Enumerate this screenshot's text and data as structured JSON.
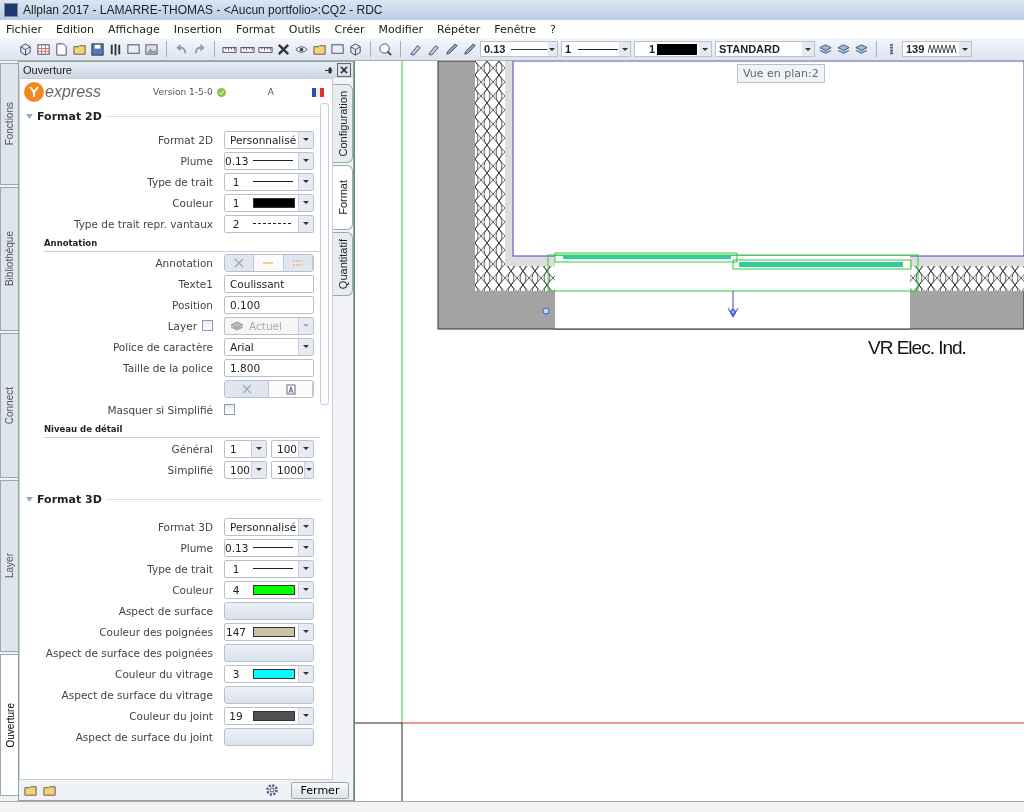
{
  "window": {
    "title": "Allplan 2017 - LAMARRE-THOMAS - <Aucun portfolio>:CQ2 - RDC"
  },
  "menu": [
    "Fichier",
    "Edition",
    "Affichage",
    "Insertion",
    "Format",
    "Outils",
    "Créer",
    "Modifier",
    "Répéter",
    "Fenêtre",
    "?"
  ],
  "toolbar": {
    "pen": "0.13",
    "line_type": "1",
    "color_number": "1",
    "layer": "STANDARD",
    "pattern": "139"
  },
  "tooltip": "Vue en plan:2",
  "left_tabs": [
    {
      "label": "Fonctions",
      "selected": false
    },
    {
      "label": "Bibliothèque",
      "selected": false
    },
    {
      "label": "Connect",
      "selected": false
    },
    {
      "label": "Layer",
      "selected": false
    },
    {
      "label": "Ouverture",
      "selected": true
    }
  ],
  "panel": {
    "title": "Ouverture",
    "logo": "express",
    "version": "Version 1-5-0",
    "language": "A",
    "right_tabs": [
      {
        "label": "Configuration",
        "selected": false
      },
      {
        "label": "Format",
        "selected": true
      },
      {
        "label": "Quantitatif",
        "selected": false
      }
    ],
    "sections": [
      {
        "title": "Format 2D",
        "expanded": true,
        "rows": [
          {
            "kind": "select",
            "label": "Format 2D",
            "value": "Personnalisé"
          },
          {
            "kind": "line",
            "label": "Plume",
            "value": "0.13"
          },
          {
            "kind": "line",
            "label": "Type de trait",
            "value": "1"
          },
          {
            "kind": "select",
            "label": "Couleur",
            "value": "1",
            "color": "#000000"
          },
          {
            "kind": "dashed",
            "label": "Type de trait repr. vantaux",
            "value": "2"
          },
          {
            "kind": "subheading",
            "label": "Annotation"
          },
          {
            "kind": "segmented",
            "label": "Annotation",
            "options": [
              {
                "selected": false
              },
              {
                "selected": true
              },
              {
                "selected": false
              }
            ]
          },
          {
            "kind": "text",
            "label": "Texte1",
            "value": "Coulissant"
          },
          {
            "kind": "text",
            "label": "Position",
            "value": "0.100"
          },
          {
            "kind": "layer",
            "label": "Layer",
            "checked": false,
            "value": "Actuel",
            "disabled": true
          },
          {
            "kind": "select",
            "label": "Police de caractère",
            "value": "Arial"
          },
          {
            "kind": "text",
            "label": "Taille de la police",
            "value": "1.800"
          },
          {
            "kind": "segmented",
            "options": [
              {
                "selected": false
              },
              {
                "selected": true
              }
            ]
          },
          {
            "kind": "checkbox",
            "label": "Masquer si Simplifié",
            "checked": false
          },
          {
            "kind": "subheading",
            "label": "Niveau de détail"
          },
          {
            "kind": "pair",
            "label": "Général",
            "values": [
              "1",
              "100"
            ]
          },
          {
            "kind": "pair",
            "label": "Simplifié",
            "values": [
              "100",
              "1000"
            ]
          }
        ]
      },
      {
        "title": "Format 3D",
        "expanded": true,
        "rows": [
          {
            "kind": "select",
            "label": "Format 3D",
            "value": "Personnalisé"
          },
          {
            "kind": "line",
            "label": "Plume",
            "value": "0.13"
          },
          {
            "kind": "line",
            "label": "Type de trait",
            "value": "1"
          },
          {
            "kind": "select",
            "label": "Couleur",
            "value": "4",
            "color": "#00ff00"
          },
          {
            "kind": "button",
            "label": "Aspect de surface"
          },
          {
            "kind": "select",
            "label": "Couleur des poignées",
            "value": "147",
            "color": "#c8c3a5"
          },
          {
            "kind": "button",
            "label": "Aspect de surface des poignées"
          },
          {
            "kind": "select",
            "label": "Couleur du vitrage",
            "value": "3",
            "color": "#00ffff"
          },
          {
            "kind": "button",
            "label": "Aspect de surface du vitrage"
          },
          {
            "kind": "select",
            "label": "Couleur du joint",
            "value": "19",
            "color": "#505050"
          },
          {
            "kind": "button",
            "label": "Aspect de surface du joint"
          }
        ]
      }
    ],
    "close_button": "Fermer"
  },
  "canvas": {
    "label": "VR Elec. Ind."
  }
}
